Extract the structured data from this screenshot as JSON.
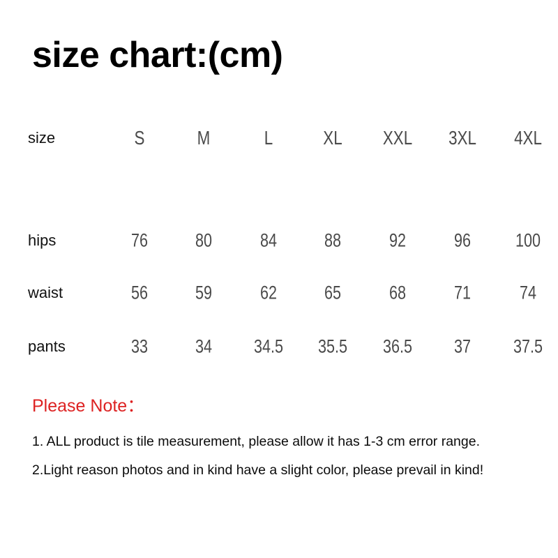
{
  "title": "size chart:(cm)",
  "colors": {
    "background": "#ffffff",
    "title_text": "#000000",
    "row_label_text": "#111111",
    "table_value_text": "#4a4a4a",
    "note_heading_red": "#dd2222",
    "note_body_text": "#0b0b0b"
  },
  "chart_data": {
    "type": "table",
    "title": "size chart:(cm)",
    "unit": "cm",
    "corner_label": "size",
    "columns": [
      "S",
      "M",
      "L",
      "XL",
      "XXL",
      "3XL",
      "4XL"
    ],
    "rows": [
      {
        "label": "hips",
        "values": [
          "76",
          "80",
          "84",
          "88",
          "92",
          "96",
          "100"
        ]
      },
      {
        "label": "waist",
        "values": [
          "56",
          "59",
          "62",
          "65",
          "68",
          "71",
          "74"
        ]
      },
      {
        "label": "pants",
        "values": [
          "33",
          "34",
          "34.5",
          "35.5",
          "36.5",
          "37",
          "37.5"
        ]
      }
    ]
  },
  "table": {
    "corner_label": "size",
    "headers": {
      "c0": "S",
      "c1": "M",
      "c2": "L",
      "c3": "XL",
      "c4": "XXL",
      "c5": "3XL",
      "c6": "4XL"
    },
    "hips": {
      "label": "hips",
      "c0": "76",
      "c1": "80",
      "c2": "84",
      "c3": "88",
      "c4": "92",
      "c5": "96",
      "c6": "100"
    },
    "waist": {
      "label": "waist",
      "c0": "56",
      "c1": "59",
      "c2": "62",
      "c3": "65",
      "c4": "68",
      "c5": "71",
      "c6": "74"
    },
    "pants": {
      "label": "pants",
      "c0": "33",
      "c1": "34",
      "c2": "34.5",
      "c3": "35.5",
      "c4": "36.5",
      "c5": "37",
      "c6": "37.5"
    }
  },
  "notes": {
    "heading": "Please Note：",
    "line1": "1. ALL product is tile measurement, please allow it has 1-3 cm error range.",
    "line2": "2.Light reason photos and in kind have a slight color, please prevail in kind!"
  }
}
